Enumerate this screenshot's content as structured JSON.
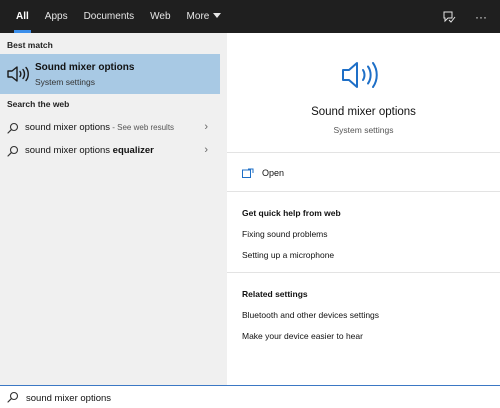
{
  "topbar": {
    "tabs": [
      {
        "label": "All",
        "active": true
      },
      {
        "label": "Apps",
        "active": false
      },
      {
        "label": "Documents",
        "active": false
      },
      {
        "label": "Web",
        "active": false
      },
      {
        "label": "More",
        "active": false
      }
    ],
    "icons": [
      "feedback-icon",
      "more-options-icon"
    ],
    "more_options_glyph": "···"
  },
  "left": {
    "best_match_label": "Best match",
    "best_match": {
      "title": "Sound mixer options",
      "subtitle": "System settings",
      "icon": "speaker-icon"
    },
    "web_label": "Search the web",
    "web_results": [
      {
        "query": "sound mixer options",
        "suffix": " - See web results"
      },
      {
        "query_prefix": "sound mixer options ",
        "query_bold": "equalizer"
      }
    ]
  },
  "right": {
    "title": "Sound mixer options",
    "subtitle": "System settings",
    "open_label": "Open",
    "quick_help_heading": "Get quick help from web",
    "quick_help_links": [
      "Fixing sound problems",
      "Setting up a microphone"
    ],
    "related_heading": "Related settings",
    "related_links": [
      "Bluetooth and other devices settings",
      "Make your device easier to hear"
    ]
  },
  "search": {
    "value": "sound mixer options"
  },
  "colors": {
    "accent": "#3b8eea",
    "selected_bg": "#a8c9e4",
    "topbar_bg": "#1f1f1f",
    "icon_blue": "#1e6fc7"
  }
}
